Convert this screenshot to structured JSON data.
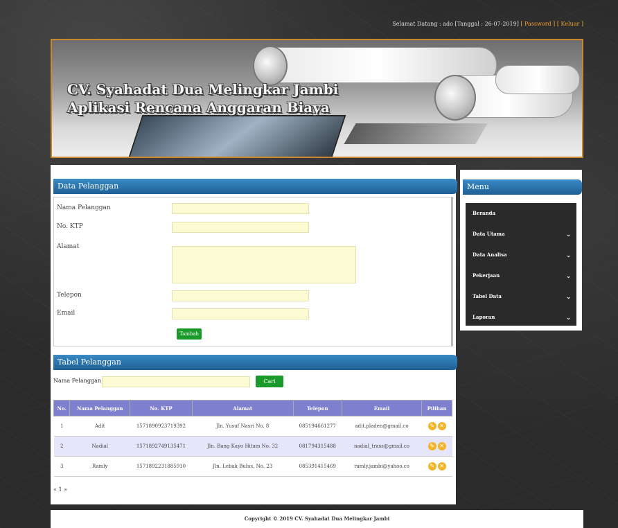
{
  "topbar": {
    "greeting": "Selamat Datang : ado [Tanggal : 26-07-2019]",
    "password_link": "[ Password ]",
    "logout_link": "[ Keluar ]"
  },
  "banner": {
    "line1": "CV. Syahadat Dua Melingkar Jambi",
    "line2": "Aplikasi Rencana Anggaran Biaya"
  },
  "form": {
    "title": "Data Pelanggan",
    "fields": {
      "nama": "Nama Pelanggan",
      "ktp": "No. KTP",
      "alamat": "Alamat",
      "telepon": "Telepon",
      "email": "Email"
    },
    "submit_label": "Tambah"
  },
  "table_section": {
    "title": "Tabel Pelanggan",
    "search_label": "Nama Pelanggan :",
    "search_value": "",
    "search_button": "Cari",
    "columns": [
      "No.",
      "Nama Pelanggan",
      "No. KTP",
      "Alamat",
      "Telepon",
      "Email",
      "Pilihan"
    ],
    "rows": [
      [
        "1",
        "Adit",
        "1571890923719392",
        "Jln. Yusuf Nasri No. 8",
        "085194661277",
        "adit.pladen@gmail.co",
        ""
      ],
      [
        "2",
        "Nadial",
        "1571892749135471",
        "Jln. Bang Kayo Hitam No. 32",
        "081794315488",
        "nadial_trass@gmail.co",
        ""
      ],
      [
        "3",
        "Ramly",
        "1571892231885910",
        "Jln. Lebak Bulus, No. 23",
        "085391415469",
        "ramly.jambi@yahoo.co",
        ""
      ]
    ],
    "pager": "« 1 »"
  },
  "menu": {
    "title": "Menu",
    "items": [
      {
        "label": "Beranda",
        "has_submenu": false
      },
      {
        "label": "Data Utama",
        "has_submenu": true
      },
      {
        "label": "Data Analisa",
        "has_submenu": true
      },
      {
        "label": "Pekerjaan",
        "has_submenu": true
      },
      {
        "label": "Tabel Data",
        "has_submenu": true
      },
      {
        "label": "Laporan",
        "has_submenu": true
      }
    ]
  },
  "footer": {
    "copyright": "Copyright © 2019 CV. Syahadat Dua Melingkar Jambi"
  },
  "colors": {
    "accent_blue": "#1d5f95",
    "button_green": "#1a9a2a",
    "table_header": "#7f7fcf",
    "input_bg": "#fdfbd4",
    "banner_border": "#c88a2a"
  }
}
